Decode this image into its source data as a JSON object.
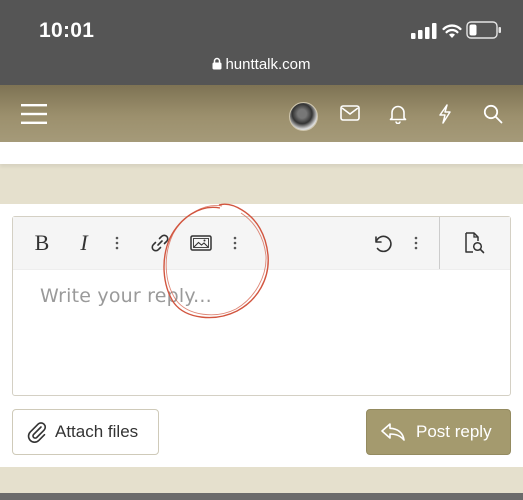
{
  "status_bar": {
    "time": "10:01",
    "url": "hunttalk.com"
  },
  "nav": {
    "icons": [
      "menu-icon",
      "avatar",
      "mail-icon",
      "bell-icon",
      "lightning-icon",
      "search-icon"
    ]
  },
  "editor": {
    "toolbar": {
      "bold": "B",
      "italic": "I",
      "icons": [
        "more-icon",
        "link-icon",
        "image-icon",
        "more-icon",
        "undo-icon",
        "more-icon",
        "preview-icon"
      ]
    },
    "placeholder": "Write your reply..."
  },
  "actions": {
    "attach_label": "Attach files",
    "post_label": "Post reply"
  },
  "colors": {
    "status_bar": "#555555",
    "nav_dark": "#7e7354",
    "nav_light": "#a59a79",
    "page_bg": "#e5e0cd",
    "post_button": "#a49a6e",
    "annotation": "#d2553f"
  }
}
